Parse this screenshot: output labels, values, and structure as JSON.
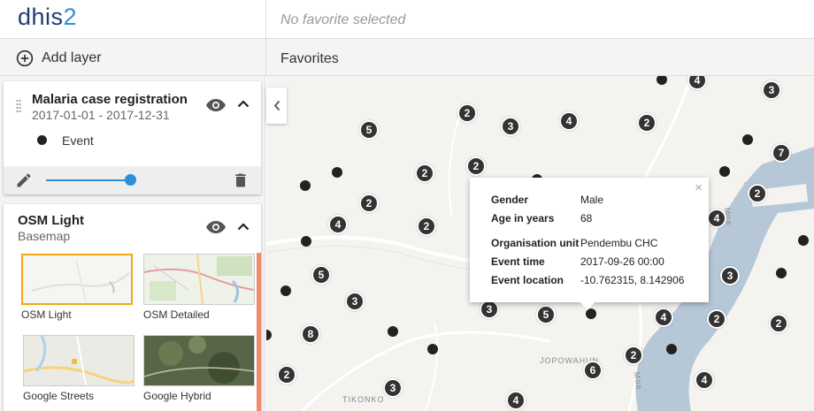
{
  "app": {
    "logo_text": "dhis",
    "logo_digit": "2"
  },
  "header": {
    "favorite_title": "No favorite selected"
  },
  "toolbar": {
    "add_layer_label": "Add layer",
    "favorites_label": "Favorites"
  },
  "layers": [
    {
      "title": "Malaria case registration",
      "subtitle": "2017-01-01 - 2017-12-31",
      "legend_label": "Event",
      "opacity": 1.0
    },
    {
      "title": "OSM Light",
      "subtitle": "Basemap"
    }
  ],
  "basemaps": [
    {
      "name": "OSM Light",
      "selected": true
    },
    {
      "name": "OSM Detailed",
      "selected": false
    },
    {
      "name": "Google Streets",
      "selected": false
    },
    {
      "name": "Google Hybrid",
      "selected": false
    }
  ],
  "map": {
    "clusters": [
      "4",
      "3",
      "2",
      "5",
      "3",
      "4",
      "2",
      "7",
      "2",
      "2",
      "2",
      "2",
      "4",
      "4",
      "2",
      "5",
      "3",
      "3",
      "5",
      "4",
      "2",
      "2",
      "8",
      "2",
      "6",
      "4",
      "2",
      "3",
      "4",
      "3"
    ],
    "place_labels": [
      "JOPOWAHUN",
      "TIKONKO",
      "Moa",
      "Moa"
    ]
  },
  "popup": {
    "close_glyph": "×",
    "rows": [
      {
        "label": "Gender",
        "value": "Male"
      },
      {
        "label": "Age in years",
        "value": "68"
      },
      {
        "label": "Organisation unit",
        "value": "Pendembu CHC"
      },
      {
        "label": "Event time",
        "value": "2017-09-26 00:00"
      },
      {
        "label": "Event location",
        "value": "-10.762315, 8.142906"
      }
    ]
  },
  "icons": [
    "add-circle-icon",
    "drag-handle-icon",
    "eye-icon",
    "chevron-up-icon",
    "pencil-icon",
    "trash-icon",
    "chevron-left-icon"
  ],
  "colors": {
    "accent": "#2e8fd8",
    "logo": "#1d3f70",
    "selected_border": "#f3a712",
    "marker": "#333333"
  }
}
